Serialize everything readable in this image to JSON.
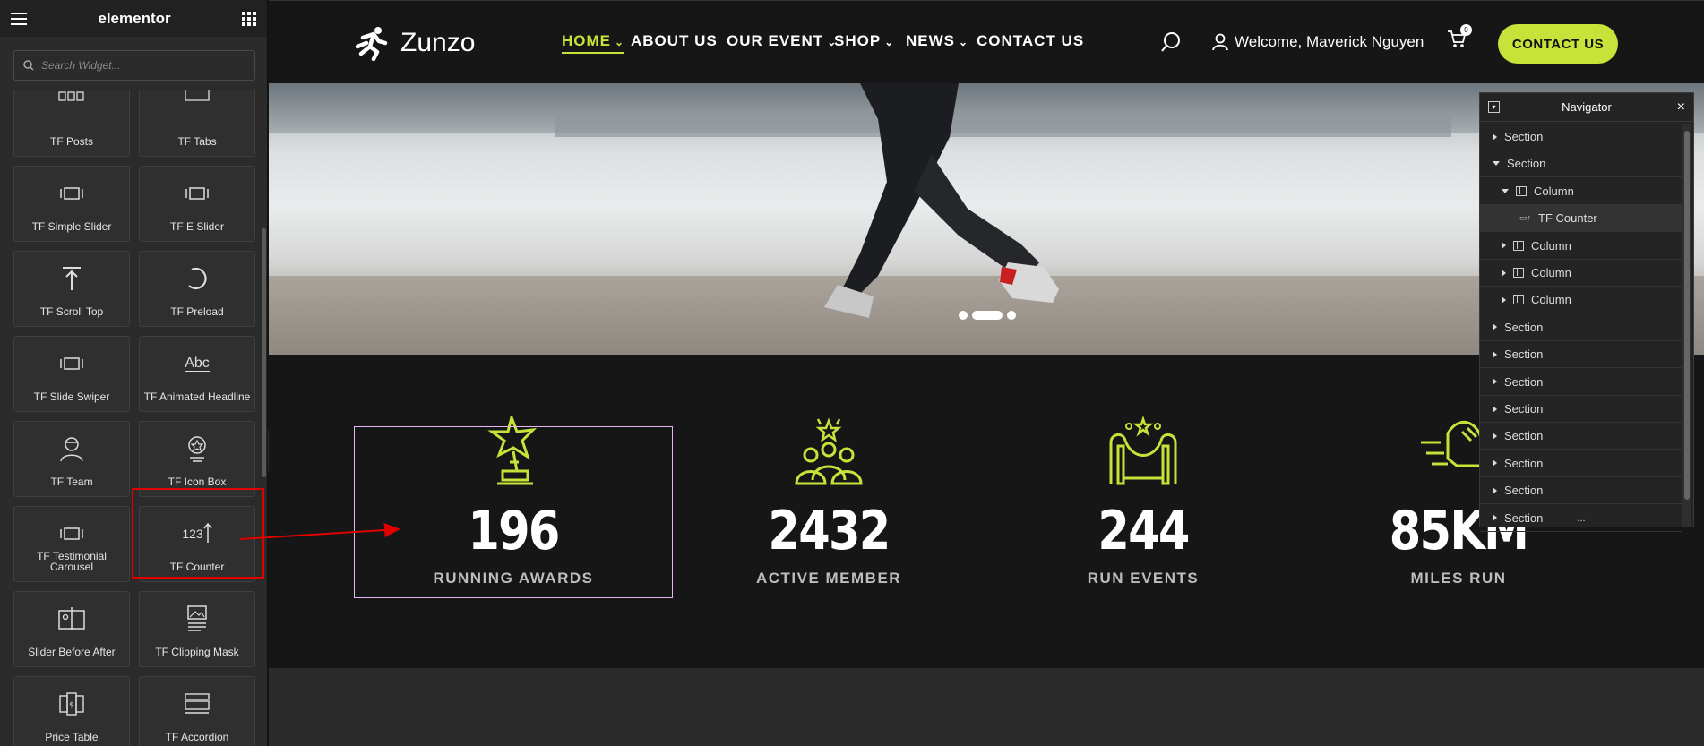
{
  "sidebar": {
    "title": "elementor",
    "search_placeholder": "Search Widget...",
    "widgets": [
      {
        "label": "TF Posts",
        "icon": "posts-icon"
      },
      {
        "label": "TF Tabs",
        "icon": "tabs-icon"
      },
      {
        "label": "TF Simple Slider",
        "icon": "slider-icon"
      },
      {
        "label": "TF E Slider",
        "icon": "slider-icon"
      },
      {
        "label": "TF Scroll Top",
        "icon": "scroll-top-icon"
      },
      {
        "label": "TF Preload",
        "icon": "preload-icon"
      },
      {
        "label": "TF Slide Swiper",
        "icon": "slider-icon"
      },
      {
        "label": "TF Animated Headline",
        "icon": "abc-icon",
        "icon_text": "Abc"
      },
      {
        "label": "TF Team",
        "icon": "team-icon"
      },
      {
        "label": "TF Icon Box",
        "icon": "icon-box-icon"
      },
      {
        "label": "TF Testimonial Carousel",
        "icon": "slider-icon"
      },
      {
        "label": "TF Counter",
        "icon": "counter-icon",
        "icon_text": "123"
      },
      {
        "label": "Slider Before After",
        "icon": "before-after-icon"
      },
      {
        "label": "TF Clipping Mask",
        "icon": "clipping-mask-icon"
      },
      {
        "label": "Price Table",
        "icon": "price-table-icon"
      },
      {
        "label": "TF Accordion",
        "icon": "accordion-icon"
      }
    ]
  },
  "header": {
    "logo_text": "Zunzo",
    "nav": [
      {
        "label": "HOME",
        "dropdown": true,
        "active": true
      },
      {
        "label": "ABOUT US",
        "dropdown": false
      },
      {
        "label": "OUR EVENT",
        "dropdown": true
      },
      {
        "label": "SHOP",
        "dropdown": true
      },
      {
        "label": "NEWS",
        "dropdown": true
      },
      {
        "label": "CONTACT US",
        "dropdown": false
      }
    ],
    "welcome": "Welcome, Maverick Nguyen",
    "cart_count": "0",
    "contact_button": "CONTACT US"
  },
  "counters": [
    {
      "value": "196",
      "label": "RUNNING AWARDS",
      "icon": "trophy-icon"
    },
    {
      "value": "2432",
      "label": "ACTIVE MEMBER",
      "icon": "members-icon"
    },
    {
      "value": "244",
      "label": "RUN EVENTS",
      "icon": "event-stage-icon"
    },
    {
      "value": "85KM",
      "label": "MILES RUN",
      "icon": "running-shoe-icon"
    }
  ],
  "navigator": {
    "title": "Navigator",
    "items": [
      {
        "label": "Section",
        "type": "section",
        "expanded": false
      },
      {
        "label": "Section",
        "type": "section",
        "expanded": true
      },
      {
        "label": "Column",
        "type": "column",
        "expanded": true
      },
      {
        "label": "TF Counter",
        "type": "widget",
        "selected": true
      },
      {
        "label": "Column",
        "type": "column",
        "expanded": false
      },
      {
        "label": "Column",
        "type": "column",
        "expanded": false
      },
      {
        "label": "Column",
        "type": "column",
        "expanded": false
      },
      {
        "label": "Section",
        "type": "section",
        "expanded": false
      },
      {
        "label": "Section",
        "type": "section",
        "expanded": false
      },
      {
        "label": "Section",
        "type": "section",
        "expanded": false
      },
      {
        "label": "Section",
        "type": "section",
        "expanded": false
      },
      {
        "label": "Section",
        "type": "section",
        "expanded": false
      },
      {
        "label": "Section",
        "type": "section",
        "expanded": false
      },
      {
        "label": "Section",
        "type": "section",
        "expanded": false
      },
      {
        "label": "Section",
        "type": "section",
        "expanded": false
      }
    ],
    "footer_dots": "..."
  },
  "colors": {
    "accent": "#c7e33a",
    "highlight_red": "#e00000",
    "selection_pink": "#e4b8ee"
  }
}
